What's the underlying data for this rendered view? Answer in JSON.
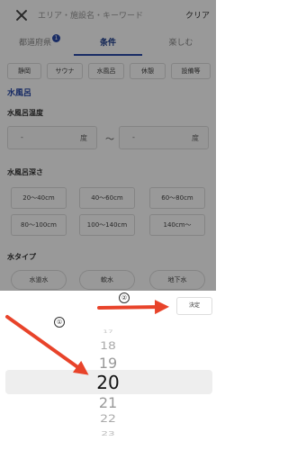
{
  "search": {
    "placeholder": "エリア・施設名・キーワード",
    "clear_label": "クリア"
  },
  "tabs": [
    {
      "label": "都道府県",
      "badge": "1"
    },
    {
      "label": "条件"
    },
    {
      "label": "楽しむ"
    }
  ],
  "chips": [
    "静岡",
    "サウナ",
    "水風呂",
    "休憩",
    "設備等"
  ],
  "section_title": "水風呂",
  "temperature": {
    "title": "水風呂温度",
    "from_value": "-",
    "to_value": "-",
    "unit": "度",
    "separator": "〜"
  },
  "depth": {
    "title": "水風呂深さ",
    "options": [
      "20〜40cm",
      "40〜60cm",
      "60〜80cm",
      "80〜100cm",
      "100〜140cm",
      "140cm〜"
    ]
  },
  "water_type": {
    "title": "水タイプ",
    "options": [
      "水道水",
      "軟水",
      "地下水"
    ]
  },
  "picker": {
    "done_label": "決定",
    "values": [
      "17",
      "18",
      "19",
      "20",
      "21",
      "22",
      "23"
    ],
    "selected": "20"
  },
  "annotations": {
    "step1": "①",
    "step2": "②",
    "arrow_color": "#e8432a"
  }
}
